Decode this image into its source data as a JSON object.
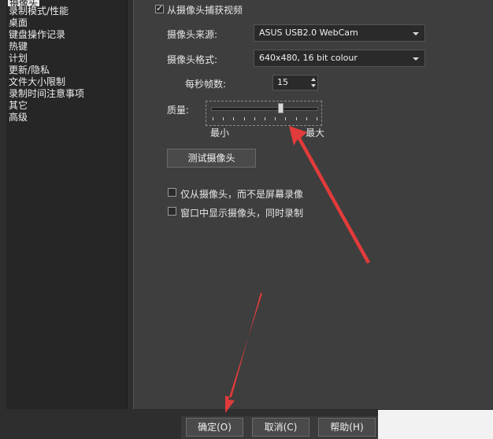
{
  "sidebar": {
    "items": [
      {
        "label": "摄像头",
        "selected": true
      },
      {
        "label": "录制模式/性能"
      },
      {
        "label": "桌面"
      },
      {
        "label": "键盘操作记录"
      },
      {
        "label": "热键"
      },
      {
        "label": "计划"
      },
      {
        "label": "更新/隐私"
      },
      {
        "label": "文件大小限制"
      },
      {
        "label": "录制时间注意事项"
      },
      {
        "label": "其它"
      },
      {
        "label": "高级"
      }
    ]
  },
  "camera": {
    "capture_label": "从摄像头捕获视频",
    "capture_checked": true,
    "source_label": "摄像头来源:",
    "source_value": "ASUS USB2.0 WebCam",
    "format_label": "摄像头格式:",
    "format_value": "640x480, 16 bit colour",
    "fps_label": "每秒帧数:",
    "fps_value": "15",
    "quality_label": "质量:",
    "quality_value": 0.65,
    "quality_min_label": "最小",
    "quality_max_label": "最大",
    "test_button": "测试摄像头",
    "only_camera_label": "仅从摄像头，而不是屏幕录像",
    "only_camera_checked": false,
    "window_show_label": "窗口中显示摄像头，同时录制",
    "window_show_checked": false
  },
  "footer": {
    "ok_label": "确定(O)",
    "cancel_label": "取消(C)",
    "help_label": "帮助(H)"
  },
  "colors": {
    "main_panel": "#3e3e3e",
    "sidebar": "#262626",
    "annotation_arrow": "#e23b3b"
  }
}
